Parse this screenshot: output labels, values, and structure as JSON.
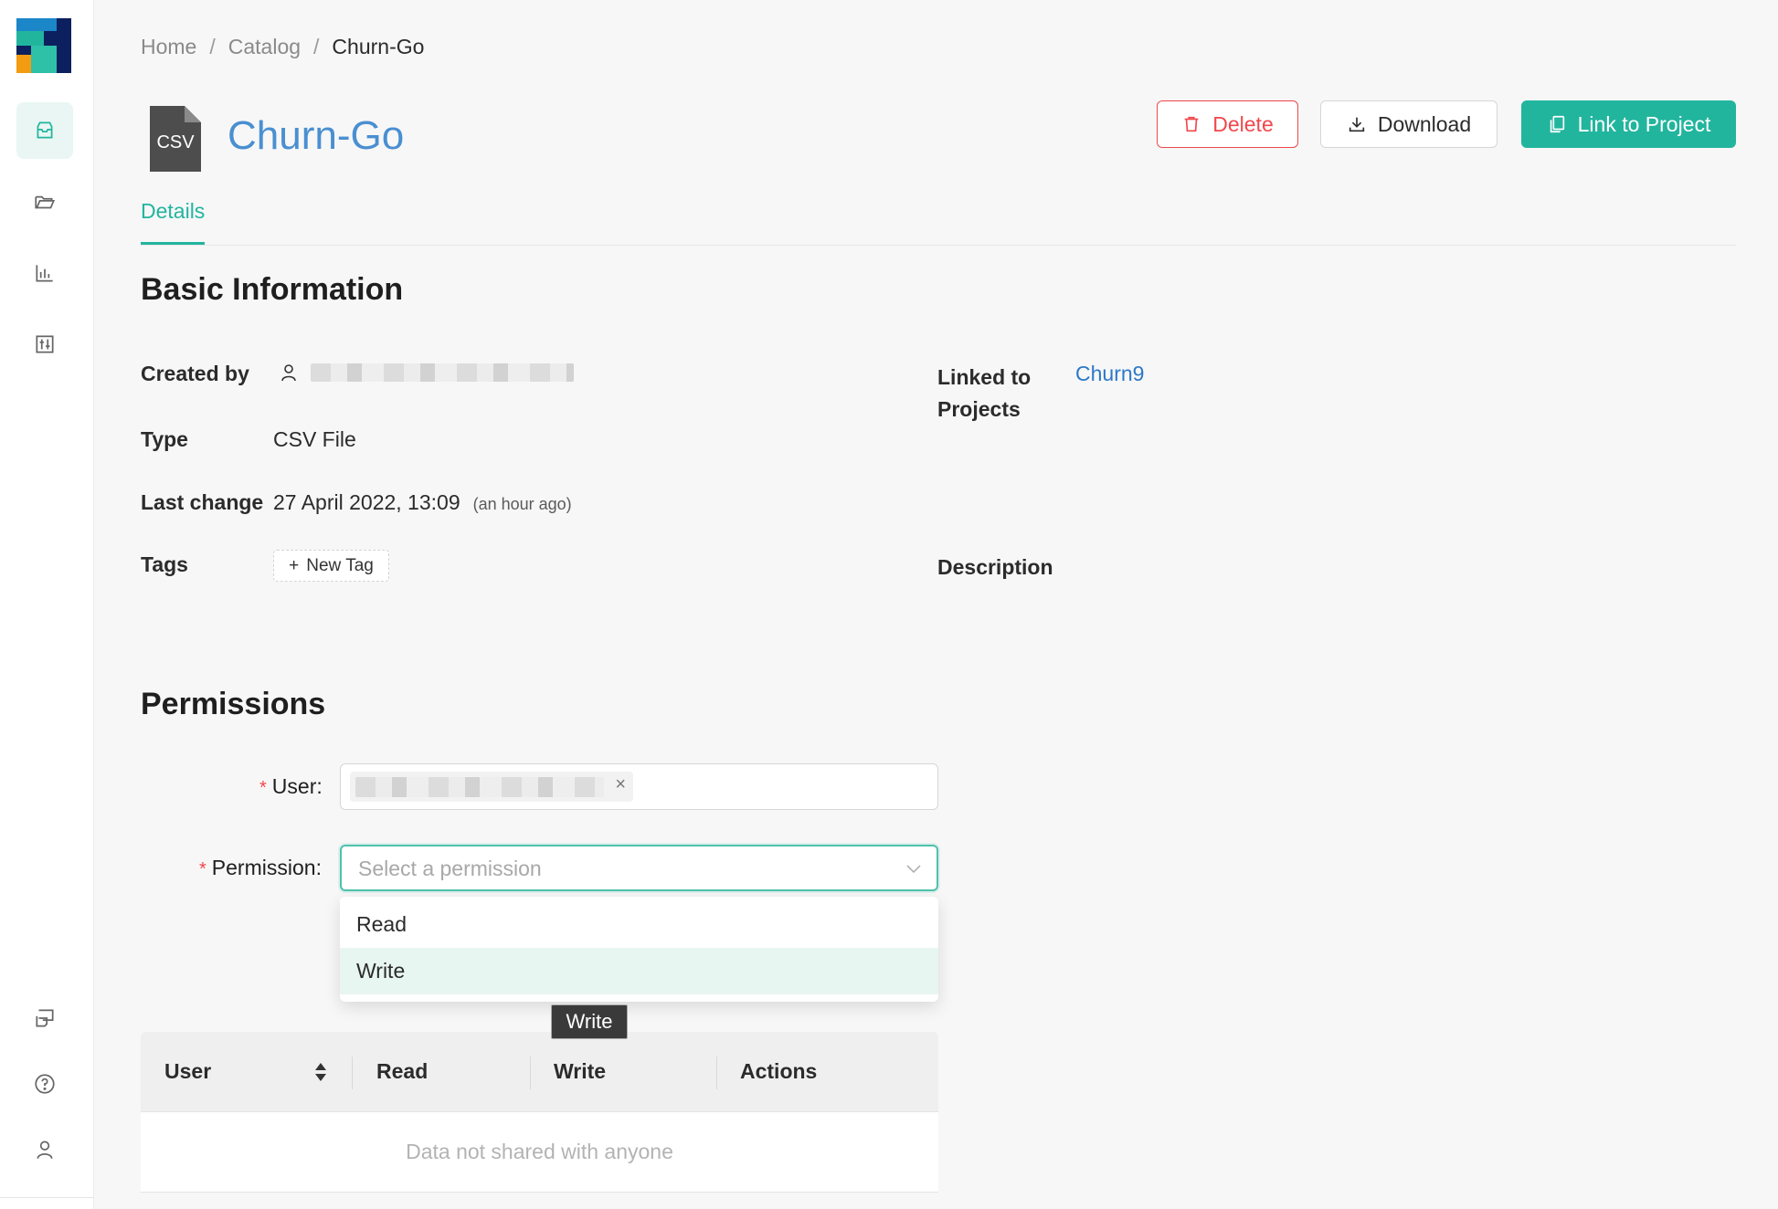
{
  "breadcrumb": {
    "home": "Home",
    "catalog": "Catalog",
    "current": "Churn-Go",
    "separator": "/"
  },
  "header": {
    "file_badge": "CSV",
    "title": "Churn-Go",
    "delete_label": "Delete",
    "download_label": "Download",
    "link_label": "Link to Project"
  },
  "tabs": [
    {
      "label": "Details",
      "active": true
    }
  ],
  "basic_info": {
    "title": "Basic Information",
    "created_by_label": "Created by",
    "type_label": "Type",
    "type_value": "CSV File",
    "last_change_label": "Last change",
    "last_change_value": "27 April 2022, 13:09",
    "last_change_relative": "(an hour ago)",
    "tags_label": "Tags",
    "new_tag_label": "New Tag",
    "linked_label_line1": "Linked to",
    "linked_label_line2": "Projects",
    "linked_project": "Churn9",
    "description_label": "Description"
  },
  "permissions": {
    "title": "Permissions",
    "user_label": "User",
    "permission_label": "Permission",
    "permission_placeholder": "Select a permission",
    "options": [
      "Read",
      "Write"
    ],
    "tooltip": "Write",
    "table": {
      "columns": [
        "User",
        "Read",
        "Write",
        "Actions"
      ],
      "empty_text": "Data not shared with anyone"
    }
  },
  "colors": {
    "accent": "#22b59e",
    "danger": "#f0474c",
    "link": "#2c78c8",
    "title": "#4a8fd1"
  },
  "icons": [
    "catalog-icon",
    "folder-icon",
    "chart-icon",
    "sliders-icon",
    "feedback-icon",
    "help-icon",
    "user-icon"
  ]
}
